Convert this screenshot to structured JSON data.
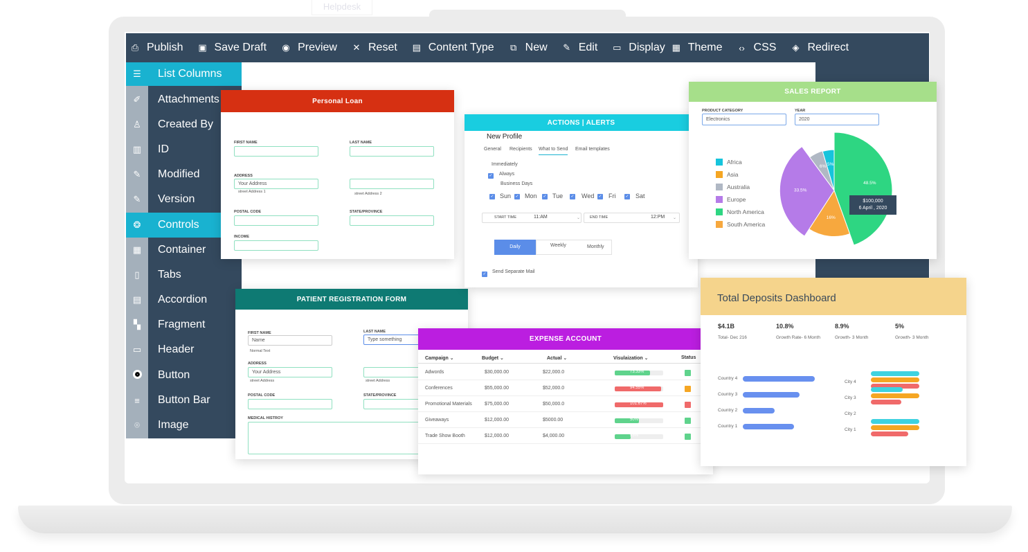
{
  "top": {
    "helpdesk": "Helpdesk"
  },
  "toolbar": [
    {
      "label": "Publish",
      "icon": "publish-icon"
    },
    {
      "label": "Save Draft",
      "icon": "save-icon"
    },
    {
      "label": "Preview",
      "icon": "eye-icon"
    },
    {
      "label": "Reset",
      "icon": "close-icon"
    },
    {
      "label": "Content Type",
      "icon": "document-icon"
    },
    {
      "label": "New",
      "icon": "external-link-icon"
    },
    {
      "label": "Edit",
      "icon": "edit-icon"
    },
    {
      "label": "Display",
      "icon": "monitor-icon"
    },
    {
      "label": "Theme",
      "icon": "layout-icon"
    },
    {
      "label": "CSS",
      "icon": "code-icon"
    },
    {
      "label": "Redirect",
      "icon": "redirect-icon"
    }
  ],
  "sidebar": [
    {
      "label": "List Columns",
      "icon": "checklist-icon"
    },
    {
      "label": "Attachments",
      "icon": "paperclip-icon"
    },
    {
      "label": "Created By",
      "icon": "user-icon"
    },
    {
      "label": "ID",
      "icon": "id-card-icon"
    },
    {
      "label": "Modified",
      "icon": "edit-doc-icon"
    },
    {
      "label": "Version",
      "icon": "version-icon"
    },
    {
      "label": "Controls",
      "icon": "palette-icon"
    },
    {
      "label": "Container",
      "icon": "grid-icon"
    },
    {
      "label": "Tabs",
      "icon": "tab-icon"
    },
    {
      "label": "Accordion",
      "icon": "accordion-icon"
    },
    {
      "label": "Fragment",
      "icon": "fragment-icon"
    },
    {
      "label": "Header",
      "icon": "header-icon"
    },
    {
      "label": "Button",
      "icon": "radio-button-icon"
    },
    {
      "label": "Button Bar",
      "icon": "bars-icon"
    },
    {
      "label": "Image",
      "icon": "camera-icon"
    }
  ],
  "loan": {
    "title": "Personal Loan",
    "first_name": "FIRST NAME",
    "last_name": "LAST NAME",
    "address": "ADDRESS",
    "address_value": "Your Address",
    "address1": "street Address 1",
    "address2": "street Address 2",
    "postal": "POSTAL CODE",
    "state": "STATE/PROVINCE",
    "income": "INCOME"
  },
  "patient": {
    "title": "PATIENT REGISTRATION FORM",
    "first_name": "FIRST NAME",
    "last_name": "LAST NAME",
    "name_placeholder": "Name",
    "type_placeholder": "Type something",
    "normal_text": "Normal Text",
    "address": "ADDRESS",
    "address_value": "Your Address",
    "street": "street Address",
    "street2": "street Address",
    "postal": "POSTAL CODE",
    "state": "STATE/PROVINCE",
    "history": "MEDICAL HISTROY"
  },
  "alerts": {
    "title": "ACTIONS | ALERTS",
    "profile": "New Profile",
    "tabs": [
      "General",
      "Recipients",
      "What to Send",
      "Email templates"
    ],
    "immediately": "Immediately",
    "always": "Always",
    "business": "Business Days",
    "days": [
      "Sun",
      "Mon",
      "Tue",
      "Wed",
      "Fri",
      "Sat"
    ],
    "start_label": "START TIME",
    "start_value": "11:AM",
    "end_label": "END TIME",
    "end_value": "12:PM",
    "freq": [
      "Daily",
      "Weekly",
      "Monthly"
    ],
    "send_mail": "Send Separate Mail"
  },
  "expense": {
    "title": "EXPENSE ACCOUNT",
    "headers": [
      "Campaign",
      "Budget",
      "Actual",
      "Visulaization",
      "Status"
    ],
    "rows": [
      {
        "campaign": "Adwords",
        "budget": "$30,000.00",
        "actual": "$22,000.0",
        "pct": "73.33%",
        "fill": 0.73,
        "color": "#5fd38c",
        "status": "#5fd38c"
      },
      {
        "campaign": "Conferences",
        "budget": "$55,000.00",
        "actual": "$52,000.0",
        "pct": "94.55%",
        "fill": 0.95,
        "color": "#f06a6a",
        "status": "#f5a623"
      },
      {
        "campaign": "Promotional Materials",
        "budget": "$75,000.00",
        "actual": "$50,000.0",
        "pct": "101.67%",
        "fill": 1.0,
        "color": "#f06a6a",
        "status": "#f06a6a"
      },
      {
        "campaign": "Giveaways",
        "budget": "$12,000.00",
        "actual": "$5000.00",
        "pct": "50%",
        "fill": 0.5,
        "color": "#5fd38c",
        "status": "#5fd38c"
      },
      {
        "campaign": "Trade Show Booth",
        "budget": "$12,000.00",
        "actual": "$4,000.00",
        "pct": "33%",
        "fill": 0.33,
        "color": "#5fd38c",
        "status": "#5fd38c"
      }
    ]
  },
  "sales": {
    "title": "SALES REPORT",
    "category_label": "PRODUCT CATEGORY",
    "category_value": "Electronics",
    "year_label": "YEAR",
    "year_value": "2020",
    "tooltip_value": "$100,000",
    "tooltip_date": "6 April , 2020"
  },
  "chart_data": {
    "type": "pie",
    "title": "SALES REPORT",
    "categories": [
      "Africa",
      "Asia",
      "Australia",
      "Europe",
      "North America",
      "South America"
    ],
    "colors": [
      "#16c4dc",
      "#f5a623",
      "#b0b8c4",
      "#b57be8",
      "#2ed682",
      "#f7a83e"
    ],
    "slices": [
      {
        "label": "North America",
        "value": 48.5,
        "text": "48.5%",
        "color": "#2ed682"
      },
      {
        "label": "South America",
        "value": 16,
        "text": "16%",
        "color": "#f7a83e"
      },
      {
        "label": "Europe",
        "value": 33.5,
        "text": "33.5%",
        "color": "#b57be8"
      },
      {
        "label": "Australia",
        "value": 6,
        "text": "6%",
        "color": "#b0b8c4"
      },
      {
        "label": "Africa",
        "value": 5,
        "text": "5%",
        "color": "#16c4dc"
      }
    ]
  },
  "deposits": {
    "title": "Total Deposits Dashboard",
    "stats": [
      {
        "value": "$4.1B",
        "label": "Total- Dec 216"
      },
      {
        "value": "10.8%",
        "label": "Growth Rate- 6 Month"
      },
      {
        "value": "8.9%",
        "label": "Growth- 3 Month"
      },
      {
        "value": "5%",
        "label": "Growth- 3 Month"
      }
    ],
    "countries": [
      "Country 4",
      "Country 3",
      "Country 2",
      "Country 1"
    ],
    "cities": [
      "City 4",
      "City 3",
      "City 2",
      "City 1"
    ]
  }
}
